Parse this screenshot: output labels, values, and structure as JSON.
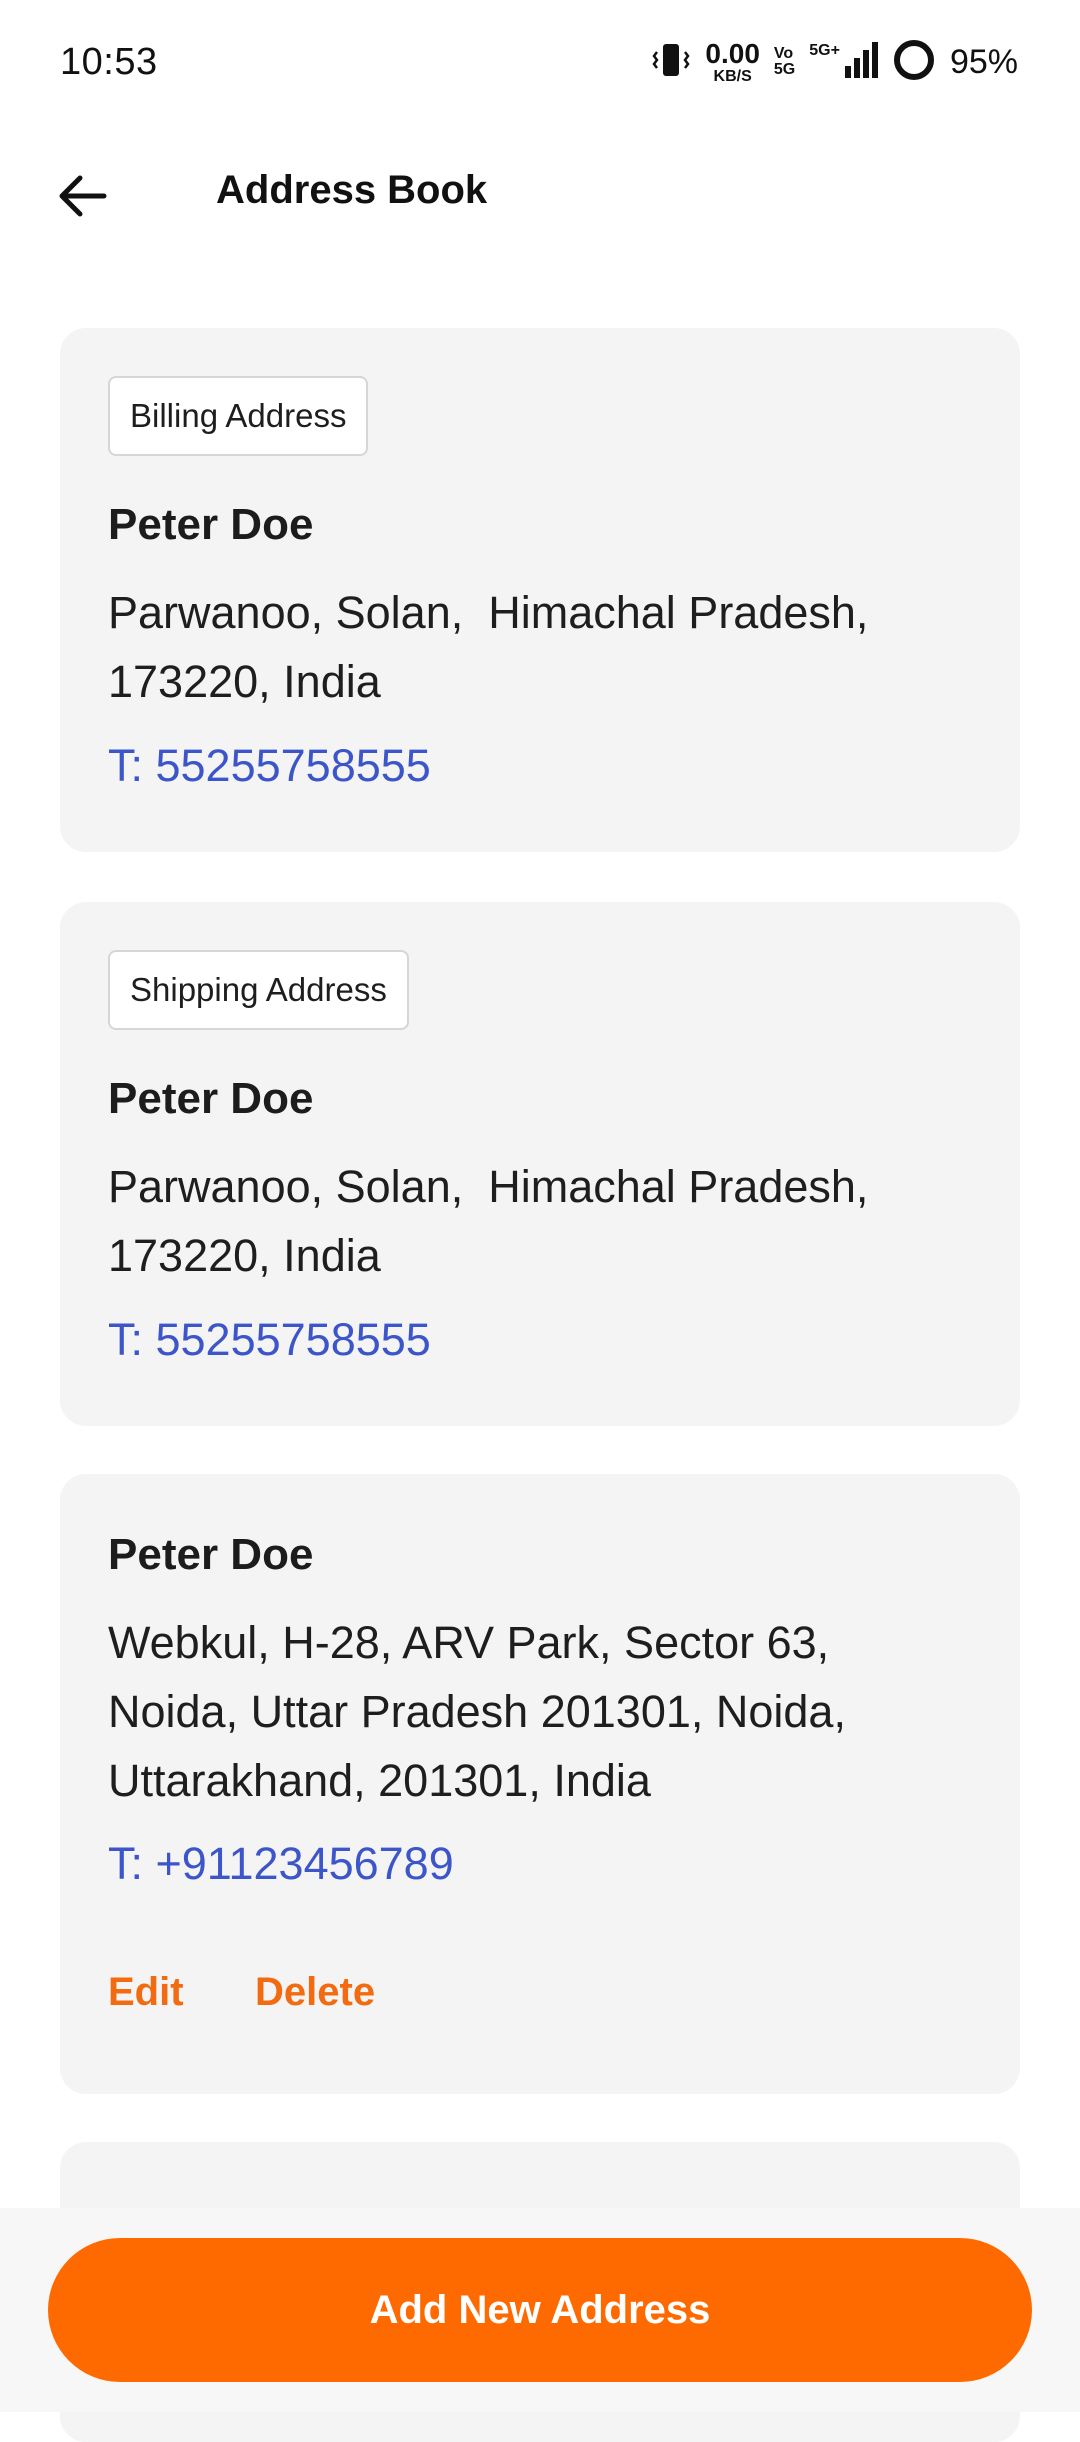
{
  "status_bar": {
    "time": "10:53",
    "net_speed": "0.00",
    "net_speed_unit": "KB/S",
    "volte_top": "Vo",
    "volte_bottom": "5G",
    "network_type": "5G+",
    "battery": "95%"
  },
  "header": {
    "title": "Address Book"
  },
  "addresses": [
    {
      "tag": "Billing Address",
      "name": "Peter Doe",
      "address": "Parwanoo, Solan,  Himachal Pradesh,\n173220, India",
      "phone": "T: 55255758555"
    },
    {
      "tag": "Shipping Address",
      "name": "Peter Doe",
      "address": "Parwanoo, Solan,  Himachal Pradesh,\n173220, India",
      "phone": "T: 55255758555"
    },
    {
      "tag": "",
      "name": "Peter Doe",
      "address": "Webkul, H-28, ARV Park, Sector 63,\nNoida, Uttar Pradesh 201301, Noida,\nUttarakhand, 201301, India",
      "phone": "T: +91123456789",
      "edit_label": "Edit",
      "delete_label": "Delete"
    }
  ],
  "bottom": {
    "add_button_label": "Add New Address"
  },
  "colors": {
    "accent": "#FF6A00",
    "action_text": "#F26B10",
    "phone_text": "#3C55C9",
    "card_bg": "#F4F4F4"
  }
}
